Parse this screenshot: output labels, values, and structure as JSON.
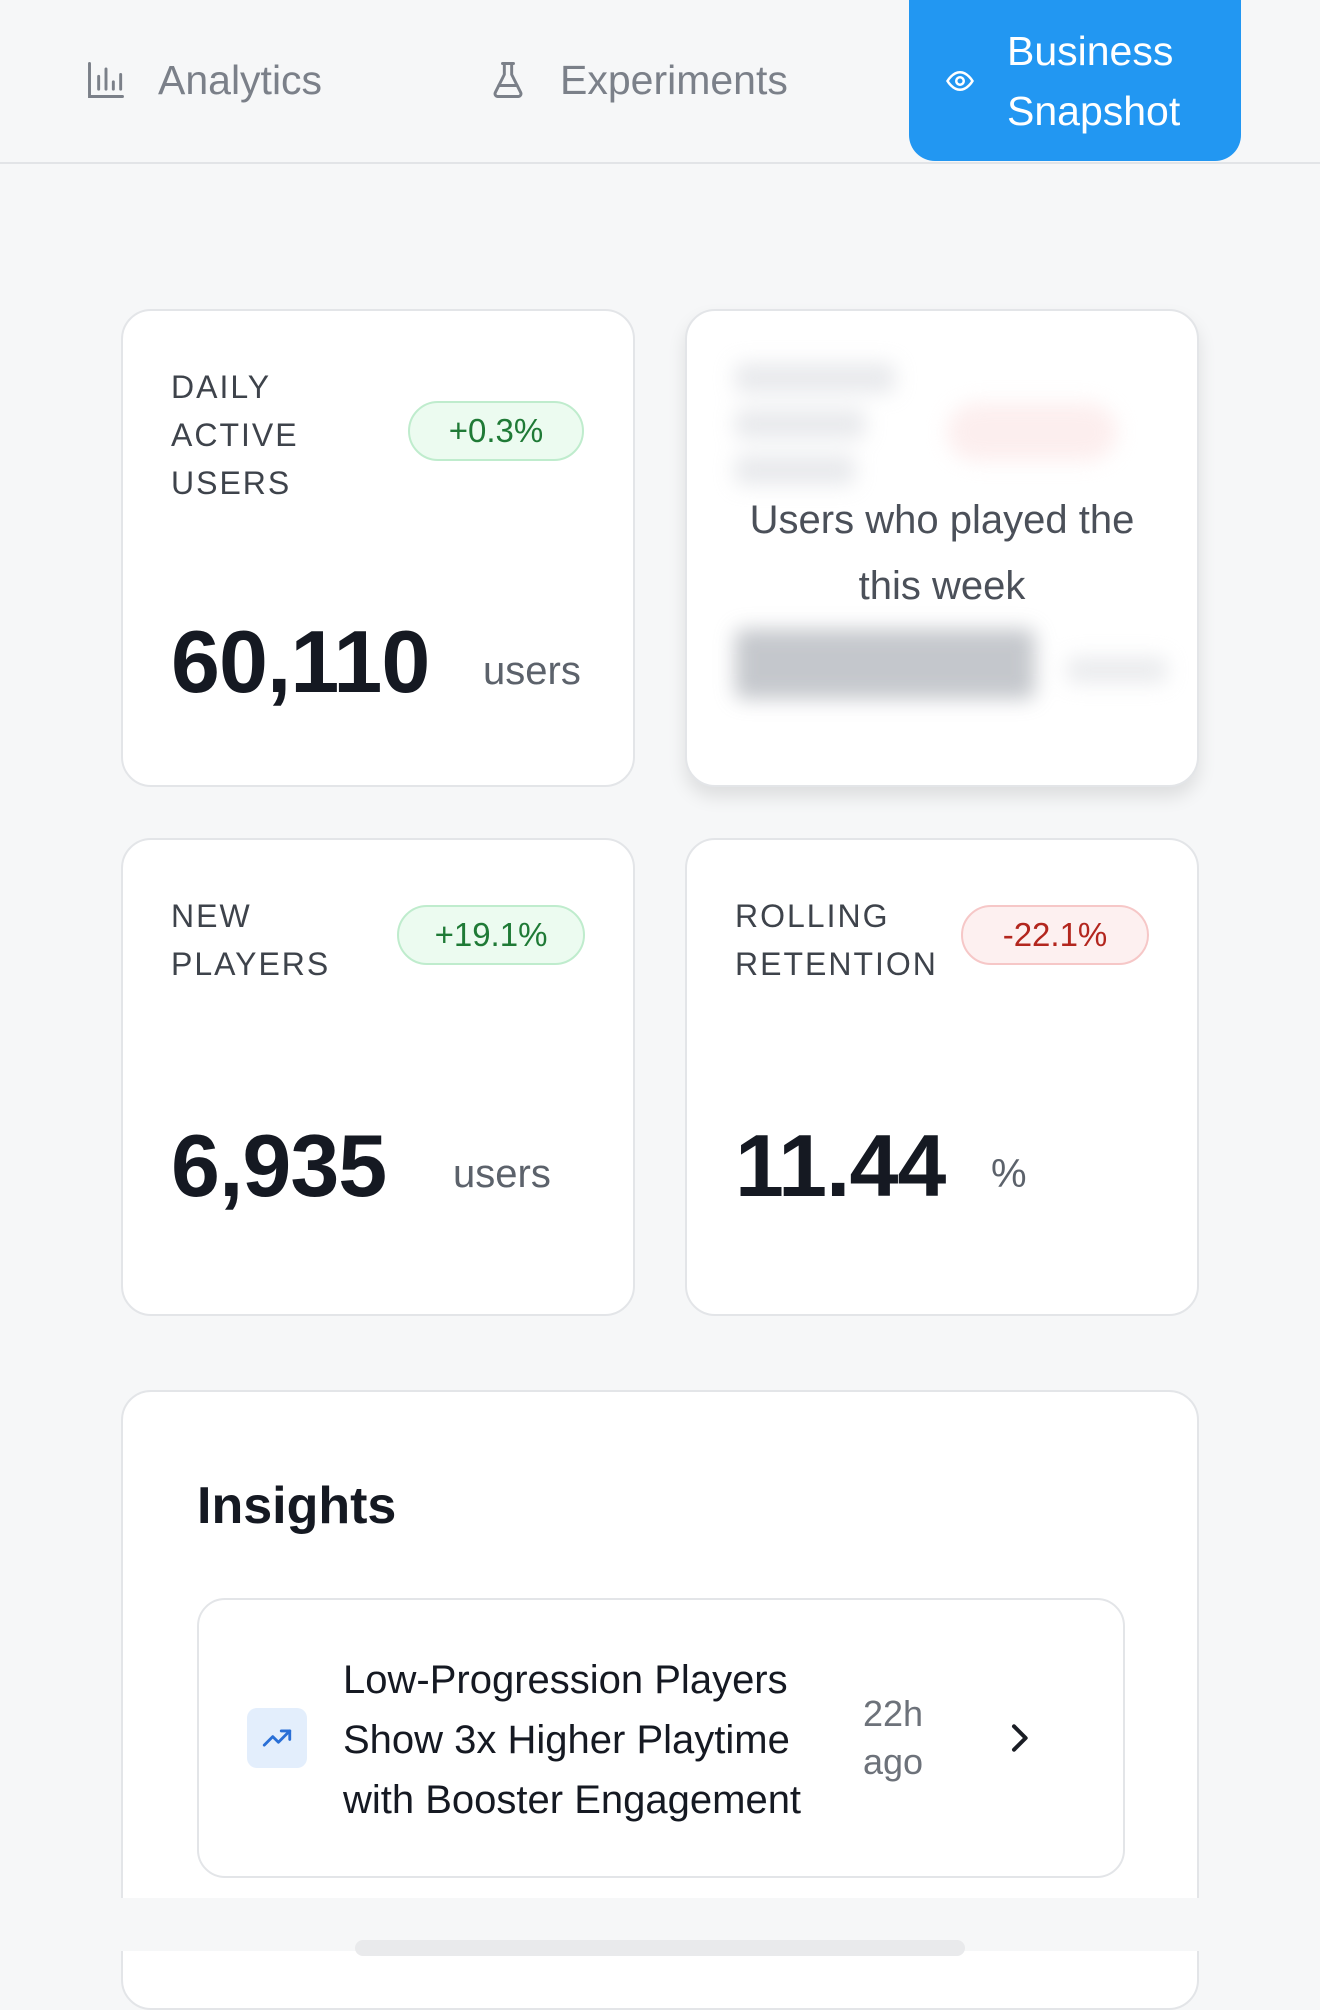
{
  "tabs": [
    {
      "label": "Analytics",
      "icon": "bar-chart-icon",
      "active": false
    },
    {
      "label": "Experiments",
      "icon": "flask-icon",
      "active": false
    },
    {
      "label": "Business Snapshot",
      "icon": "eye-icon",
      "active": true
    }
  ],
  "metrics": {
    "dau": {
      "title": "DAILY ACTIVE USERS",
      "change": "+0.3%",
      "value": "60,110",
      "unit": "users"
    },
    "wau": {
      "tooltip": "Users who played the this week"
    },
    "new_players": {
      "title": "NEW PLAYERS",
      "change": "+19.1%",
      "value": "6,935",
      "unit": "users"
    },
    "retention": {
      "title": "ROLLING RETENTION",
      "change": "-22.1%",
      "value": "11.44",
      "unit": "%"
    }
  },
  "insights": {
    "title": "Insights",
    "items": [
      {
        "icon": "trending-up-icon",
        "text": "Low-Progression Players Show 3x Higher Playtime with Booster Engagement",
        "time": "22h ago"
      }
    ]
  },
  "colors": {
    "accent": "#2297f2",
    "positive": "#1f7a36",
    "negative": "#b3261e",
    "background": "#f6f7f8"
  }
}
